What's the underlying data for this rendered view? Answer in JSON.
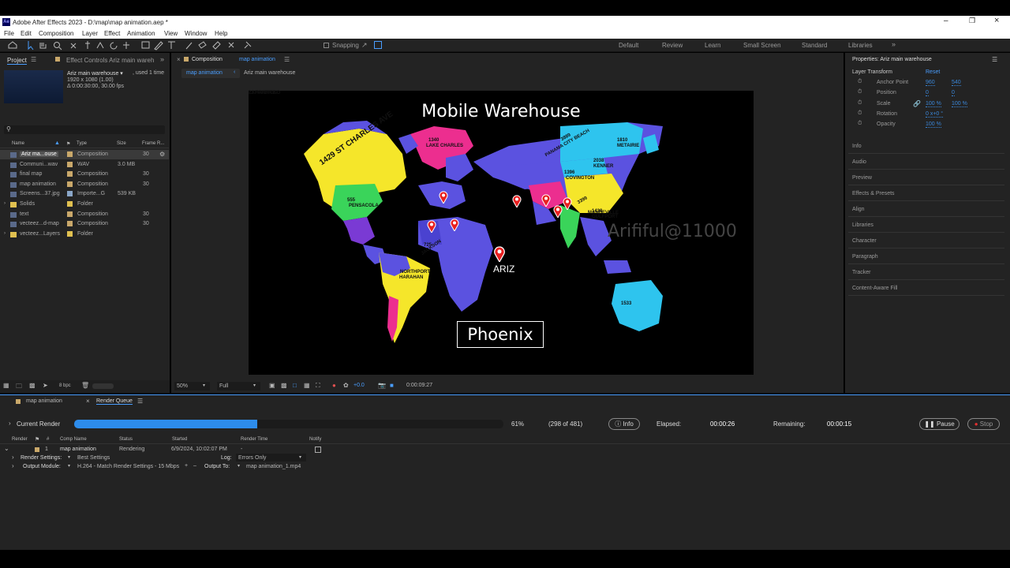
{
  "window": {
    "title": "Adobe After Effects 2023 - D:\\map\\map animation.aep *",
    "app_icon": "Ae"
  },
  "menu": [
    "File",
    "Edit",
    "Composition",
    "Layer",
    "Effect",
    "Animation",
    "View",
    "Window",
    "Help"
  ],
  "toolbar": {
    "snapping": "Snapping",
    "workspaces": [
      "Default",
      "Review",
      "Learn",
      "Small Screen",
      "Standard",
      "Libraries"
    ]
  },
  "project": {
    "tab_project": "Project",
    "tab_effects": "Effect Controls Ariz main wareh",
    "selected_name": "Ariz main warehouse ▾",
    "used": ", used 1 time",
    "dims": "1920 x 1080 (1.00)",
    "duration": "Δ 0:00:30:00, 30.00 fps",
    "col_name": "Name",
    "col_type": "Type",
    "col_size": "Size",
    "col_frame": "Frame R...",
    "bpc": "8 bpc",
    "items": [
      {
        "name": "Ariz ma...ouse",
        "type": "Composition",
        "size": "",
        "frame": "30",
        "color": "#c9a86a",
        "selected": true
      },
      {
        "name": "Communi...wav",
        "type": "WAV",
        "size": "3.0 MB",
        "frame": "",
        "color": "#c9a86a",
        "selected": false
      },
      {
        "name": "final map",
        "type": "Composition",
        "size": "",
        "frame": "30",
        "color": "#c9a86a",
        "selected": false
      },
      {
        "name": "map animation",
        "type": "Composition",
        "size": "",
        "frame": "30",
        "color": "#c9a86a",
        "selected": false
      },
      {
        "name": "Screens...37.jpg",
        "type": "Importe...G",
        "size": "539 KB",
        "frame": "",
        "color": "#8aa6c8",
        "selected": false
      },
      {
        "name": "Solids",
        "type": "Folder",
        "size": "",
        "frame": "",
        "color": "#e0c050",
        "selected": false
      },
      {
        "name": "text",
        "type": "Composition",
        "size": "",
        "frame": "30",
        "color": "#c9a86a",
        "selected": false
      },
      {
        "name": "vecteez...d-map",
        "type": "Composition",
        "size": "",
        "frame": "30",
        "color": "#c9a86a",
        "selected": false
      },
      {
        "name": "vecteez...Layers",
        "type": "Folder",
        "size": "",
        "frame": "",
        "color": "#e0c050",
        "selected": false
      }
    ]
  },
  "composition": {
    "tab_label": "Composition",
    "tab_name": "map animation",
    "crumb_1": "map animation",
    "crumb_2": "Ariz main warehouse",
    "zoom": "50%",
    "resolution": "Full",
    "exposure": "+0.0",
    "timecode": "0:00:09:27",
    "map_title": "Mobile Warehouse",
    "city_box": "Phoenix",
    "watermark": "Arififul@11000",
    "ariz_label": "ARIZ",
    "labels": [
      {
        "t": "1429 ST CHARLES AVE"
      },
      {
        "t": "1340"
      },
      {
        "t": "LAKE CHARLES"
      },
      {
        "t": "1810"
      },
      {
        "t": "METAIRIE"
      },
      {
        "t": "2038"
      },
      {
        "t": "KENNER"
      },
      {
        "t": "3889"
      },
      {
        "t": "PANAMA CITY BEACH"
      },
      {
        "t": "1396"
      },
      {
        "t": "COVINGTON"
      },
      {
        "t": "555"
      },
      {
        "t": "PENSACOLA"
      },
      {
        "t": "3399"
      },
      {
        "t": "MANDEVILLE"
      },
      {
        "t": "1438"
      },
      {
        "t": "GULFPORT"
      },
      {
        "t": "725"
      },
      {
        "t": "JACKSON"
      },
      {
        "t": "NORTHPORT"
      },
      {
        "t": "HARAHAN"
      },
      {
        "t": "1533"
      },
      {
        "t": "LAFAYETTE"
      },
      {
        "t": "22 HAMMOND"
      }
    ]
  },
  "properties": {
    "title": "Properties: Ariz main warehouse",
    "section": "Layer Transform",
    "reset": "Reset",
    "rows": [
      {
        "label": "Anchor Point",
        "v1": "960",
        "v2": "540"
      },
      {
        "label": "Position",
        "v1": "0",
        "v2": "0"
      },
      {
        "label": "Scale",
        "v1": "100 %",
        "v2": "100 %"
      },
      {
        "label": "Rotation",
        "v1": "0 x+0 °",
        "v2": ""
      },
      {
        "label": "Opacity",
        "v1": "100 %",
        "v2": ""
      }
    ],
    "panels": [
      "Info",
      "Audio",
      "Preview",
      "Effects & Presets",
      "Align",
      "Libraries",
      "Character",
      "Paragraph",
      "Tracker",
      "Content-Aware Fill"
    ]
  },
  "render": {
    "tab_map": "map animation",
    "tab_queue": "Render Queue",
    "current_render": "Current Render",
    "progress": 0.61,
    "percent": "61%",
    "frames": "(298 of 481)",
    "info": "Info",
    "elapsed_label": "Elapsed:",
    "elapsed": "00:00:26",
    "remaining_label": "Remaining:",
    "remaining": "00:00:15",
    "pause": "Pause",
    "stop": "Stop",
    "headers": {
      "render": "Render",
      "num": "#",
      "comp": "Comp Name",
      "status": "Status",
      "started": "Started",
      "time": "Render Time",
      "notify": "Notify"
    },
    "item": {
      "num": "1",
      "comp": "map animation",
      "status": "Rendering",
      "started": "6/9/2024, 10:02:07 PM",
      "time": "-"
    },
    "settings_label": "Render Settings:",
    "settings_value": "Best Settings",
    "log_label": "Log:",
    "log_value": "Errors Only",
    "output_label": "Output Module:",
    "output_value": "H.264 - Match Render Settings - 15 Mbps",
    "output_to_label": "Output To:",
    "output_to_value": "map animation_1.mp4"
  },
  "colors": {
    "accent": "#2d8ceb",
    "progress": "#2d8ceb",
    "panel": "#232323",
    "panel_dark": "#1b1b1b"
  }
}
